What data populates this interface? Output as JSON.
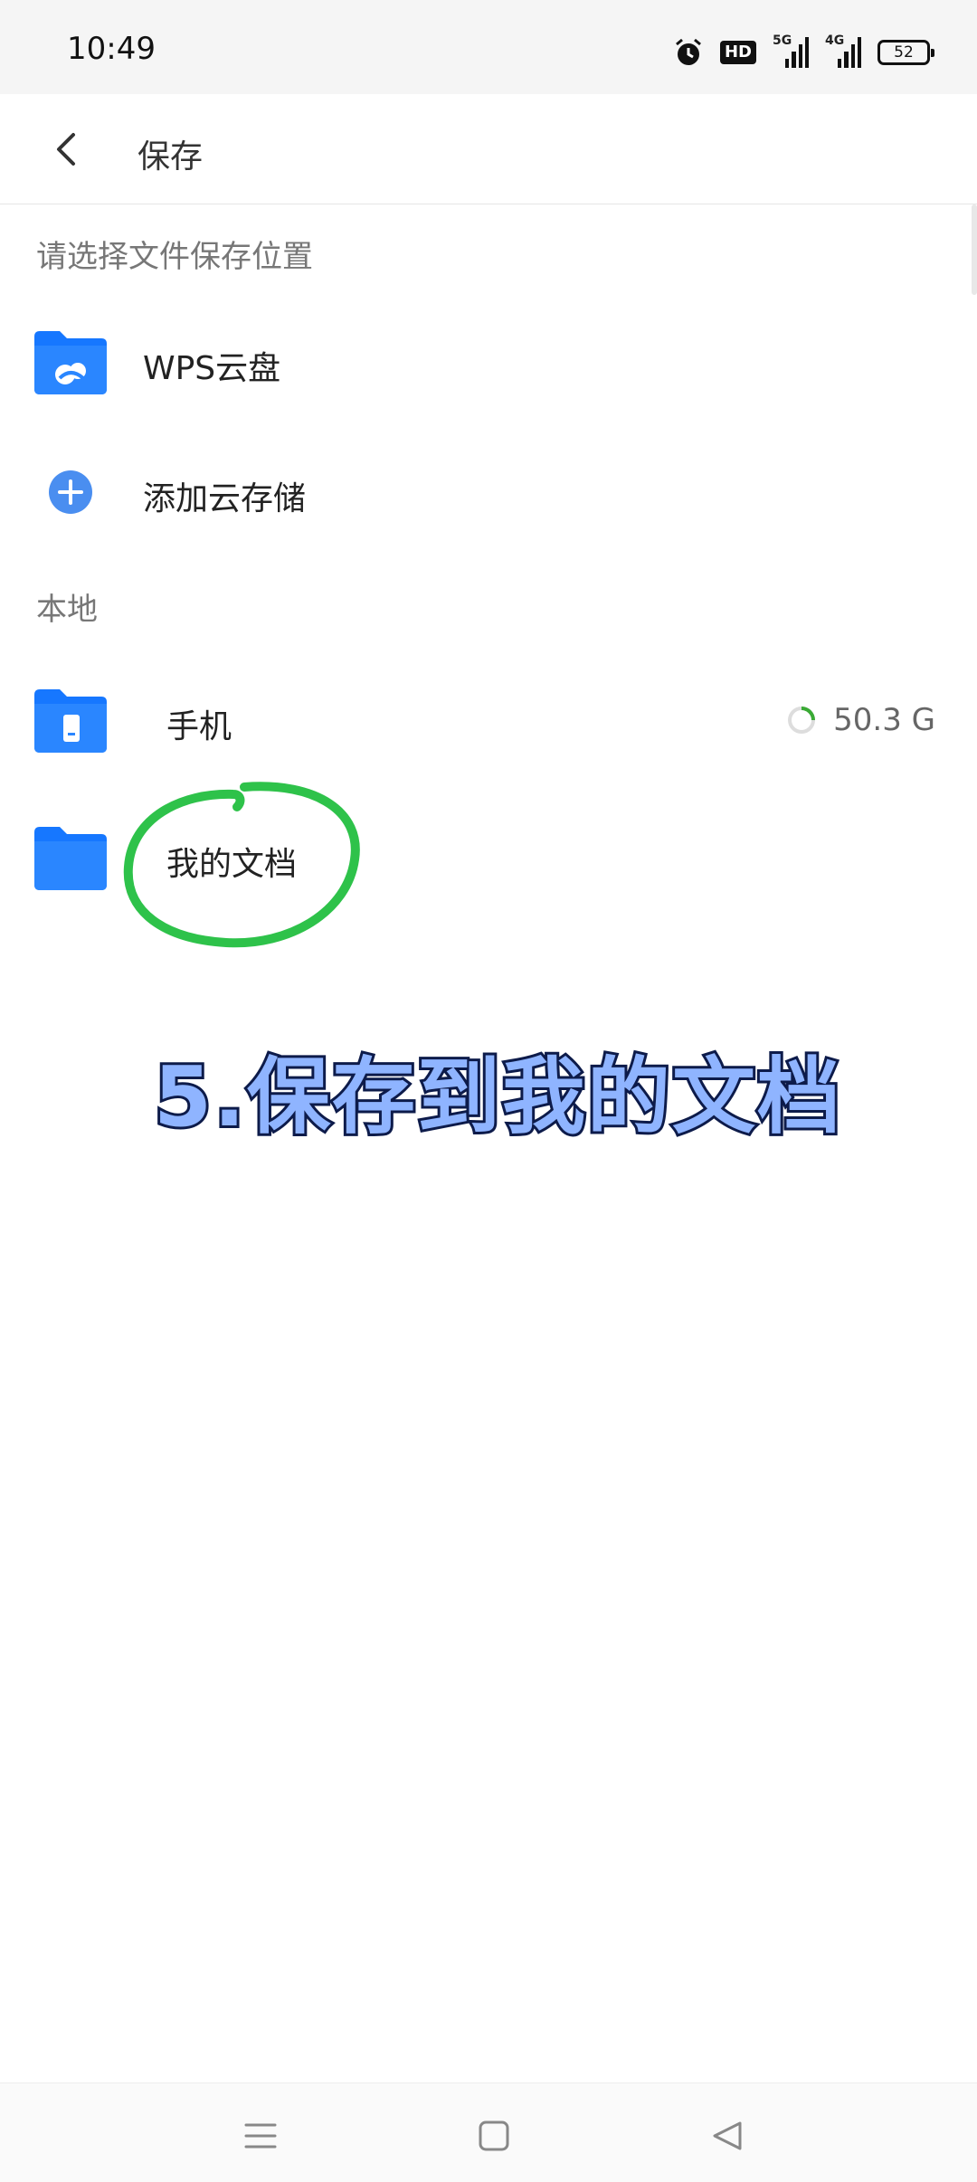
{
  "status_bar": {
    "time": "10:49",
    "hd_label": "HD",
    "signal1_label": "5G",
    "signal2_label": "4G",
    "battery": "52",
    "icons": [
      "alarm-icon",
      "hd-icon",
      "signal-5g-icon",
      "signal-4g-icon",
      "battery-icon"
    ]
  },
  "header": {
    "title": "保存",
    "back_icon": "chevron-left-icon"
  },
  "sections": {
    "cloud_label": "请选择文件保存位置",
    "local_label": "本地"
  },
  "cloud_items": [
    {
      "label": "WPS云盘",
      "icon": "cloud-folder-icon"
    },
    {
      "label": "添加云存储",
      "icon": "add-circle-icon"
    }
  ],
  "local_items": [
    {
      "label": "手机",
      "icon": "phone-folder-icon",
      "storage": "50.3 G"
    },
    {
      "label": "我的文档",
      "icon": "folder-icon"
    }
  ],
  "annotation": {
    "caption": "5.保存到我的文档",
    "circle_color": "#2ec24a",
    "caption_color": "#8fb4ff"
  },
  "nav_bar": {
    "icons": [
      "menu-icon",
      "home-icon",
      "back-icon"
    ]
  },
  "colors": {
    "accent": "#1a73e8",
    "folder": "#1677ff",
    "add_button": "#4a8ef0",
    "storage_ring_used": "#3aaa35"
  }
}
